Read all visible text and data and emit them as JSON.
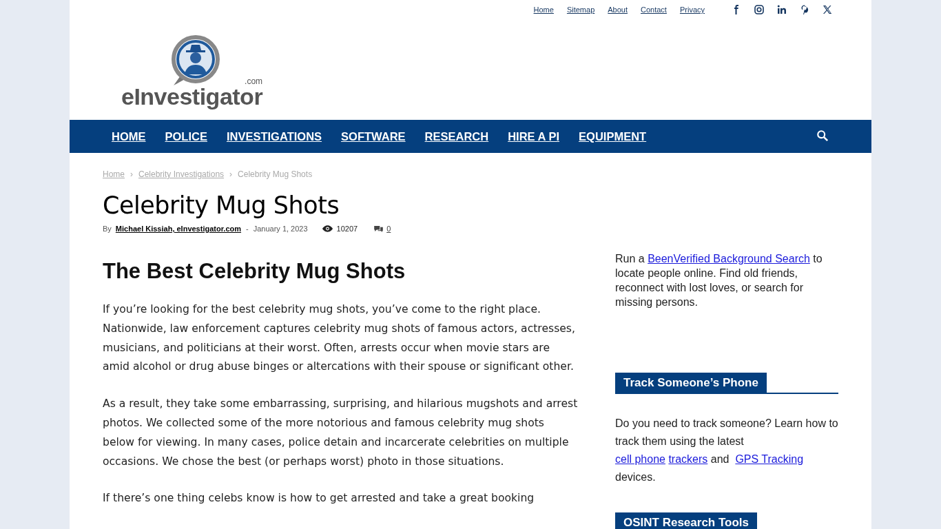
{
  "top_links": [
    "Home",
    "Sitemap",
    "About",
    "Contact",
    "Privacy"
  ],
  "social": [
    {
      "kind": "facebook"
    },
    {
      "kind": "instagram"
    },
    {
      "kind": "linkedin"
    },
    {
      "kind": "pinterest"
    },
    {
      "kind": "x"
    }
  ],
  "logo": {
    "name": "eInvestigator",
    "suffix": ".com"
  },
  "nav": [
    "HOME",
    "POLICE",
    "INVESTIGATIONS",
    "SOFTWARE",
    "RESEARCH",
    "HIRE A PI",
    "EQUIPMENT"
  ],
  "breadcrumb": {
    "links": [
      "Home",
      "Celebrity Investigations"
    ],
    "separator": "›",
    "current": "Celebrity Mug Shots"
  },
  "title": "Celebrity Mug Shots",
  "meta": {
    "by": "By",
    "author": "Michael Kissiah, eInvestigator.com",
    "dash": "-",
    "date": "January 1, 2023",
    "views": "10207",
    "comments": "0"
  },
  "article": {
    "heading": "The Best Celebrity Mug Shots",
    "paragraphs": [
      "If you’re looking for the best celebrity mug shots, you’ve come to the right place. Nationwide, law enforcement captures celebrity mug shots of famous actors, actresses, musicians, and politicians at their worst. Often, arrests occur when movie stars are amid alcohol or drug abuse binges or altercations with their spouse or significant other.",
      "As a result, they take some embarrassing, surprising, and hilarious mugshots and arrest photos. We collected some of the more notorious and famous celebrity mug shots below for viewing. In many cases, police detain and incarcerate celebrities on multiple occasions. We chose the best (or perhaps worst) photo in those situations.",
      "If there’s one thing celebs know is how to get arrested and take a great booking"
    ]
  },
  "sidebar": [
    {
      "kind": "text",
      "parts": [
        {
          "kind": "text",
          "text": "Run a "
        },
        {
          "kind": "link",
          "text": "BeenVerified Background Search"
        },
        {
          "kind": "text",
          "text": " to locate people online. Find old friends, reconnect with lost loves, or search for missing persons."
        }
      ]
    },
    {
      "kind": "heading",
      "title": "Track Someone’s Phone"
    },
    {
      "kind": "text",
      "parts": [
        {
          "kind": "text",
          "text": "Do you need to track someone? Learn how to track them using the latest "
        },
        {
          "kind": "link",
          "text": "cell phone"
        },
        {
          "kind": "link",
          "text": "trackers"
        },
        {
          "kind": "text",
          "text": " and "
        },
        {
          "kind": "link",
          "text": "GPS Tracking"
        },
        {
          "kind": "text",
          "text": " devices."
        }
      ]
    },
    {
      "kind": "heading",
      "title": "OSINT Research Tools"
    }
  ]
}
